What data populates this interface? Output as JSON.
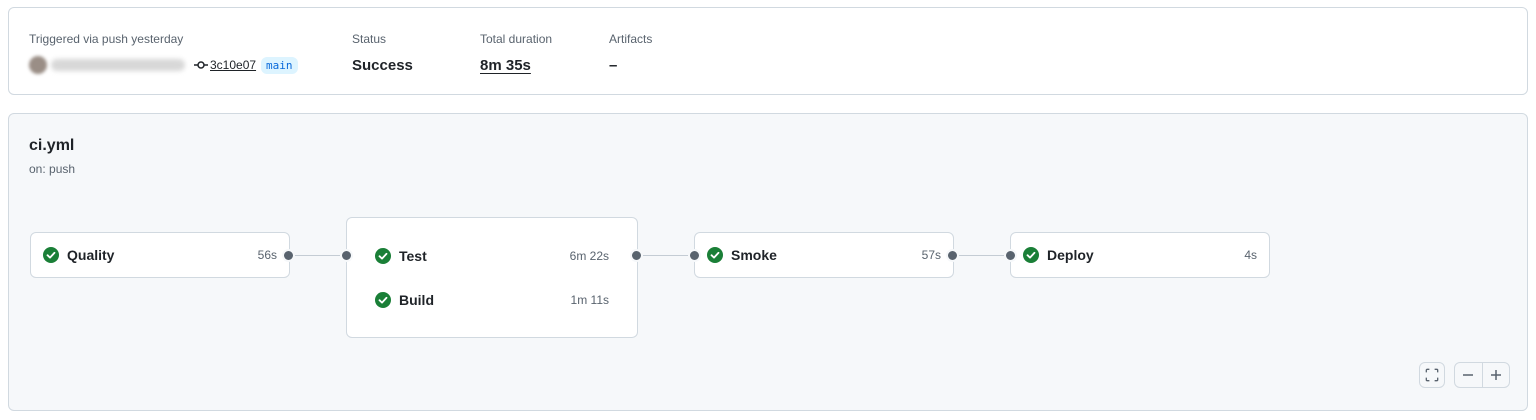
{
  "summary": {
    "trigger_label": "Triggered via push yesterday",
    "commit_sha": "3c10e07",
    "branch": "main",
    "status_label": "Status",
    "status_value": "Success",
    "duration_label": "Total duration",
    "duration_value": "8m 35s",
    "artifacts_label": "Artifacts",
    "artifacts_value": "–"
  },
  "workflow": {
    "file": "ci.yml",
    "trigger": "on: push"
  },
  "jobs": {
    "quality": {
      "name": "Quality",
      "duration": "56s",
      "status": "success"
    },
    "test": {
      "name": "Test",
      "duration": "6m 22s",
      "status": "success"
    },
    "build": {
      "name": "Build",
      "duration": "1m 11s",
      "status": "success"
    },
    "smoke": {
      "name": "Smoke",
      "duration": "57s",
      "status": "success"
    },
    "deploy": {
      "name": "Deploy",
      "duration": "4s",
      "status": "success"
    }
  },
  "colors": {
    "success": "#1a7f37",
    "link": "#0969da",
    "muted": "#59636e",
    "border": "#d1d9e0"
  },
  "icons": {
    "commit": "git-commit-icon",
    "success": "check-circle-fill-icon",
    "fullscreen": "screen-full-icon",
    "zoom_out": "minus-icon",
    "zoom_in": "plus-icon"
  }
}
